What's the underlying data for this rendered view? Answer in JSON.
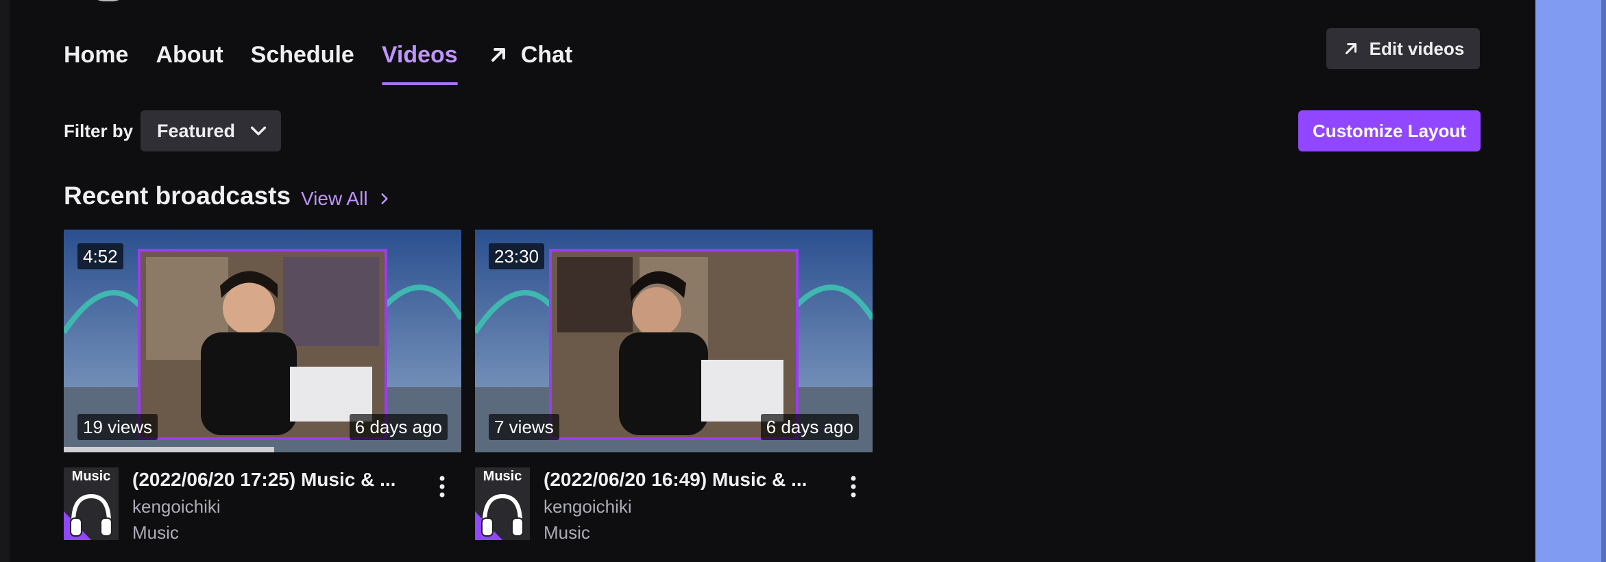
{
  "nav": {
    "tabs": [
      {
        "label": "Home"
      },
      {
        "label": "About"
      },
      {
        "label": "Schedule"
      },
      {
        "label": "Videos"
      },
      {
        "label": "Chat",
        "icon": "external-arrow-icon"
      }
    ],
    "active": "Videos",
    "edit_videos_label": "Edit videos"
  },
  "filter": {
    "label": "Filter by",
    "selected": "Featured",
    "customize_label": "Customize Layout"
  },
  "section": {
    "title": "Recent broadcasts",
    "view_all_label": "View All"
  },
  "videos": [
    {
      "duration": "4:52",
      "views": "19 views",
      "age": "6 days ago",
      "title": "(2022/06/20 17:25) Music & ...",
      "channel": "kengoichiki",
      "category": "Music",
      "category_art_text": "Music",
      "watch_progress": 0.53
    },
    {
      "duration": "23:30",
      "views": "7 views",
      "age": "6 days ago",
      "title": "(2022/06/20 16:49) Music & ...",
      "channel": "kengoichiki",
      "category": "Music",
      "category_art_text": "Music",
      "watch_progress": 0
    }
  ],
  "colors": {
    "background": "#0e0e10",
    "accent_purple": "#9147ff",
    "active_tab": "#bf94ff",
    "button_gray": "#2f2f35",
    "side_panel": "#7f9cf2"
  }
}
